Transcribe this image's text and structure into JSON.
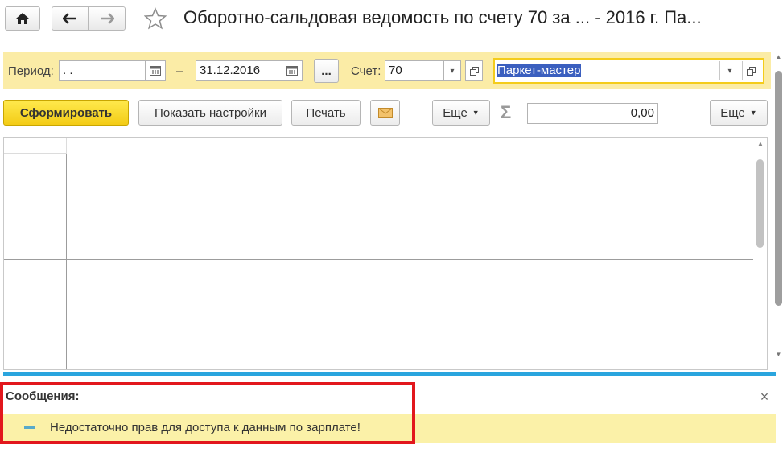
{
  "window": {
    "title": "Оборотно-сальдовая ведомость по счету 70 за ... - 2016 г. Па..."
  },
  "nav": {
    "home_icon": "home-icon",
    "back_icon": "arrow-left-icon",
    "forward_icon": "arrow-right-icon",
    "favorite_icon": "star-icon"
  },
  "filters": {
    "period_label": "Период:",
    "period_from": " .  .",
    "dash": "–",
    "period_to": "31.12.2016",
    "ellipsis": "...",
    "account_label": "Счет:",
    "account_value": "70",
    "organization_value": "Паркет-мастер"
  },
  "toolbar": {
    "generate": "Сформировать",
    "show_settings": "Показать настройки",
    "print": "Печать",
    "more": "Еще",
    "sum_value": "0,00",
    "more2": "Еще"
  },
  "messages": {
    "title": "Сообщения:",
    "items": [
      {
        "text": "Недостаточно прав для доступа к данным по зарплате!"
      }
    ]
  },
  "colors": {
    "accent_yellow": "#f3cc16",
    "filter_bg": "#fbeca6",
    "message_bar": "#2aa5de",
    "highlight_frame": "#e2171d",
    "selection": "#3b5fbf"
  }
}
